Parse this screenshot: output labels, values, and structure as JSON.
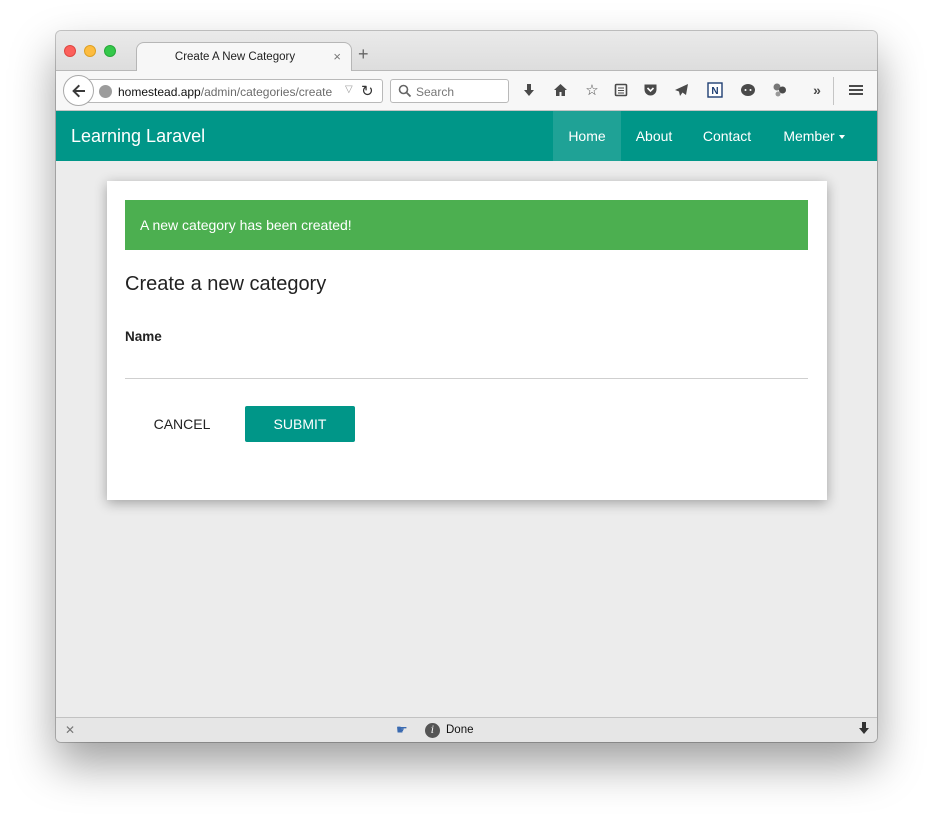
{
  "browser": {
    "tab_title": "Create A New Category",
    "tab_close": "×",
    "new_tab": "+",
    "url_host": "homestead.app",
    "url_path": "/admin/categories/create",
    "search_placeholder": "Search",
    "toolbar_icons": [
      "downloads-icon",
      "home-icon",
      "bookmark-star-icon",
      "reading-list-icon",
      "pocket-icon",
      "send-icon",
      "extension-n-icon",
      "chat-icon",
      "extension-icon",
      "overflow-icon",
      "menu-icon"
    ],
    "status_text": "Done"
  },
  "site": {
    "brand": "Learning Laravel",
    "nav": [
      {
        "label": "Home",
        "active": true
      },
      {
        "label": "About",
        "active": false
      },
      {
        "label": "Contact",
        "active": false
      },
      {
        "label": "Member",
        "active": false,
        "dropdown": true
      }
    ]
  },
  "main": {
    "alert": "A new category has been created!",
    "title": "Create a new category",
    "name_label": "Name",
    "name_value": "",
    "cancel_label": "CANCEL",
    "submit_label": "SUBMIT"
  },
  "colors": {
    "primary": "#009688",
    "success": "#4caf50",
    "background": "#ececec"
  }
}
